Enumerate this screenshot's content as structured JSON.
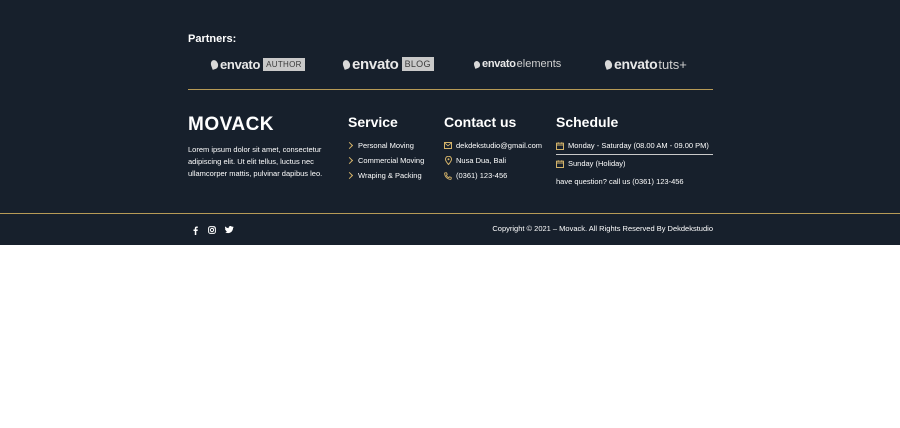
{
  "partners": {
    "title": "Partners:",
    "logos": [
      {
        "word": "envato",
        "tag": "AUTHOR"
      },
      {
        "word": "envato",
        "tag": "BLOG"
      },
      {
        "word": "envato",
        "tag": "elements"
      },
      {
        "word": "envato",
        "tag": "tuts+"
      }
    ]
  },
  "brand": {
    "name": "MOVACK",
    "about": "Lorem ipsum dolor sit amet, consectetur adipiscing elit. Ut elit tellus, luctus nec ullamcorper mattis, pulvinar dapibus leo."
  },
  "service": {
    "title": "Service",
    "items": [
      "Personal Moving",
      "Commercial Moving",
      "Wraping & Packing"
    ]
  },
  "contact": {
    "title": "Contact us",
    "email": "dekdekstudio@gmail.com",
    "address": "Nusa Dua, Bali",
    "phone": "(0361) 123-456"
  },
  "schedule": {
    "title": "Schedule",
    "weekday": "Monday - Saturday (08.00 AM - 09.00 PM)",
    "sunday": "Sunday (Holiday)",
    "question": "have question? call us (0361) 123-456"
  },
  "footer": {
    "copyright": "Copyright © 2021 – Movack. All Rights Reserved By Dekdekstudio",
    "social_icons": [
      "facebook-icon",
      "instagram-icon",
      "twitter-icon"
    ]
  },
  "colors": {
    "background": "#17202c",
    "accent": "#b79a56"
  }
}
